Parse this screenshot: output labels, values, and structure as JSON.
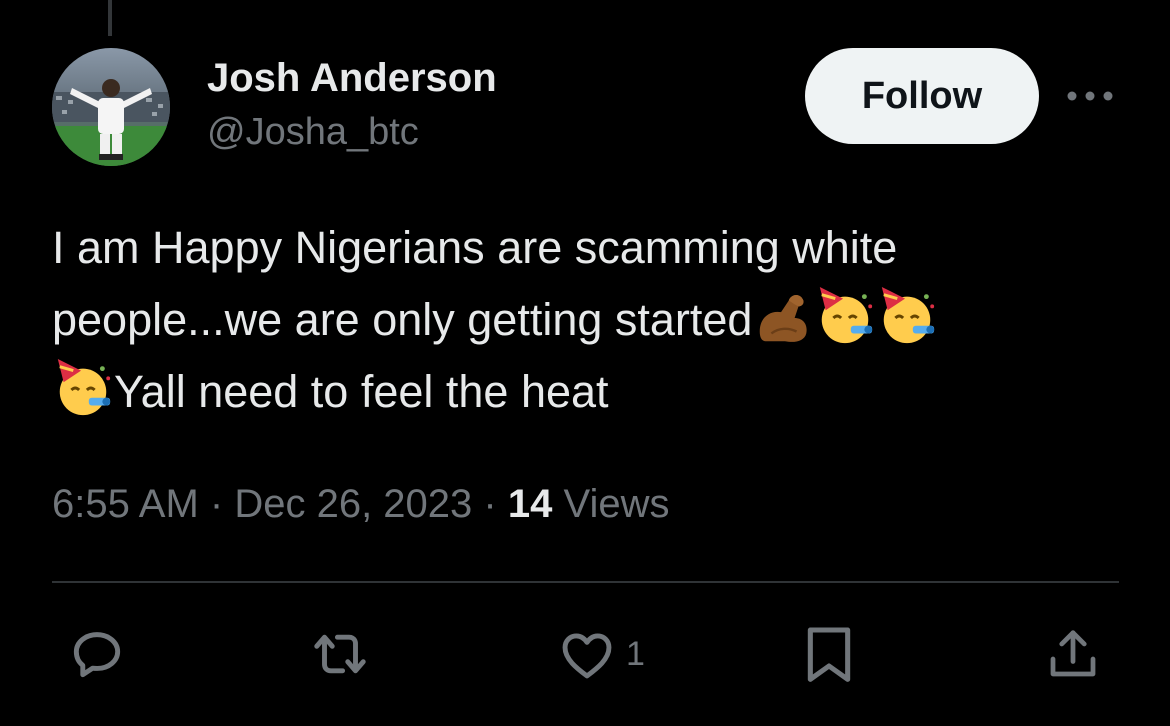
{
  "author": {
    "display_name": "Josh Anderson",
    "handle": "@Josha_btc",
    "avatar_icon": "profile-photo-soccer-player"
  },
  "follow_button": {
    "label": "Follow"
  },
  "more_menu": {
    "icon": "more-horizontal-icon"
  },
  "tweet": {
    "line1": "I am Happy Nigerians are scamming white",
    "line2": "people...we are only getting started",
    "line3": "Yall need to feel the heat",
    "emojis": [
      "flexed-biceps-medium-dark",
      "partying-face",
      "partying-face",
      "partying-face"
    ]
  },
  "meta": {
    "time": "6:55 AM",
    "separator": "·",
    "date": "Dec 26, 2023",
    "views_count": "14",
    "views_label": "Views"
  },
  "actions": {
    "reply_icon": "reply-icon",
    "retweet_icon": "retweet-icon",
    "like_icon": "heart-icon",
    "like_count": "1",
    "bookmark_icon": "bookmark-icon",
    "share_icon": "share-icon"
  },
  "colors": {
    "background": "#000000",
    "text_primary": "#e7e9ea",
    "text_secondary": "#71767b",
    "divider": "#2f3336",
    "button_bg": "#eff3f4"
  }
}
